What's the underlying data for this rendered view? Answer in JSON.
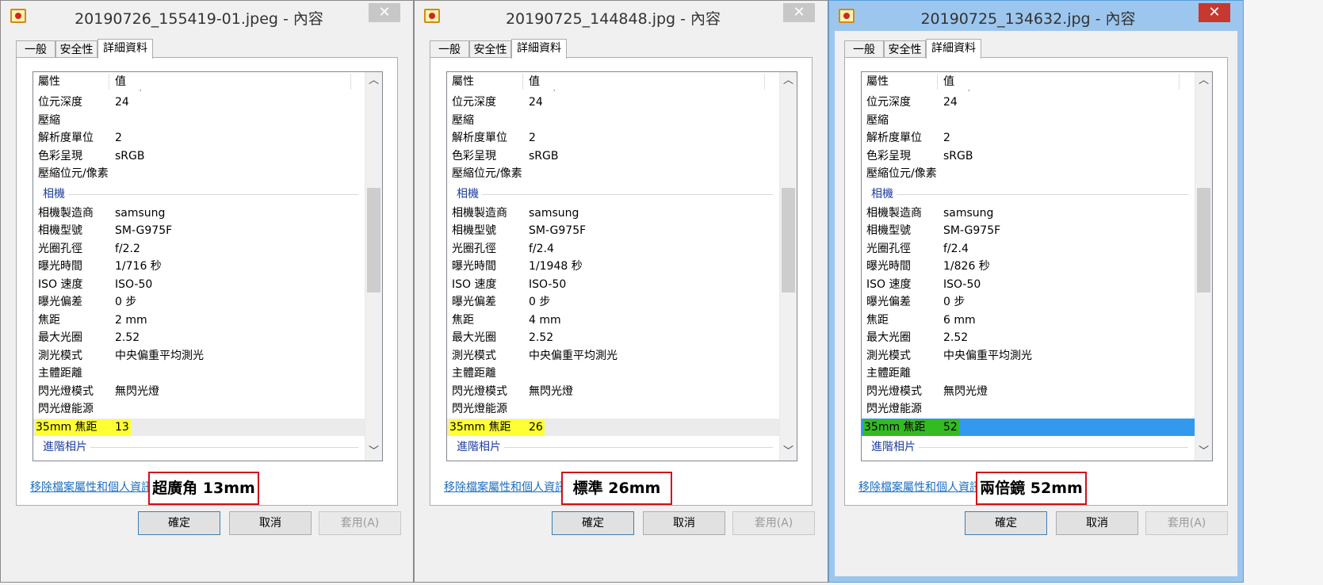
{
  "windows": [
    {
      "title": "20190726_155419-01.jpeg - 內容",
      "tabs": [
        "一般",
        "安全性",
        "詳細資料"
      ],
      "header": {
        "property": "屬性",
        "value": "值"
      },
      "rows": [
        {
          "k": "位元深度",
          "v": "24"
        },
        {
          "k": "壓縮",
          "v": ""
        },
        {
          "k": "解析度單位",
          "v": "2"
        },
        {
          "k": "色彩呈現",
          "v": "sRGB"
        },
        {
          "k": "壓縮位元/像素",
          "v": ""
        }
      ],
      "group_camera": "相機",
      "camera_rows": [
        {
          "k": "相機製造商",
          "v": "samsung"
        },
        {
          "k": "相機型號",
          "v": "SM-G975F"
        },
        {
          "k": "光圈孔徑",
          "v": "f/2.2"
        },
        {
          "k": "曝光時間",
          "v": "1/716 秒"
        },
        {
          "k": "ISO 速度",
          "v": "ISO-50"
        },
        {
          "k": "曝光偏差",
          "v": "0 步"
        },
        {
          "k": "焦距",
          "v": "2 mm"
        },
        {
          "k": "最大光圈",
          "v": "2.52"
        },
        {
          "k": "測光模式",
          "v": "中央偏重平均測光"
        },
        {
          "k": "主體距離",
          "v": ""
        },
        {
          "k": "閃光燈模式",
          "v": "無閃光燈"
        },
        {
          "k": "閃光燈能源",
          "v": ""
        },
        {
          "k": "35mm 焦距",
          "v": "13"
        }
      ],
      "group_advanced": "進階相片",
      "link": "移除檔案屬性和個人資訊",
      "annotation": "超廣角 13mm",
      "buttons": {
        "ok": "確定",
        "cancel": "取消",
        "apply": "套用(A)"
      }
    },
    {
      "title": "20190725_144848.jpg - 內容",
      "tabs": [
        "一般",
        "安全性",
        "詳細資料"
      ],
      "header": {
        "property": "屬性",
        "value": "值"
      },
      "rows": [
        {
          "k": "位元深度",
          "v": "24"
        },
        {
          "k": "壓縮",
          "v": ""
        },
        {
          "k": "解析度單位",
          "v": "2"
        },
        {
          "k": "色彩呈現",
          "v": "sRGB"
        },
        {
          "k": "壓縮位元/像素",
          "v": ""
        }
      ],
      "group_camera": "相機",
      "camera_rows": [
        {
          "k": "相機製造商",
          "v": "samsung"
        },
        {
          "k": "相機型號",
          "v": "SM-G975F"
        },
        {
          "k": "光圈孔徑",
          "v": "f/2.4"
        },
        {
          "k": "曝光時間",
          "v": "1/1948 秒"
        },
        {
          "k": "ISO 速度",
          "v": "ISO-50"
        },
        {
          "k": "曝光偏差",
          "v": "0 步"
        },
        {
          "k": "焦距",
          "v": "4 mm"
        },
        {
          "k": "最大光圈",
          "v": "2.52"
        },
        {
          "k": "測光模式",
          "v": "中央偏重平均測光"
        },
        {
          "k": "主體距離",
          "v": ""
        },
        {
          "k": "閃光燈模式",
          "v": "無閃光燈"
        },
        {
          "k": "閃光燈能源",
          "v": ""
        },
        {
          "k": "35mm 焦距",
          "v": "26"
        }
      ],
      "group_advanced": "進階相片",
      "link": "移除檔案屬性和個人資訊",
      "annotation": "標準 26mm",
      "buttons": {
        "ok": "確定",
        "cancel": "取消",
        "apply": "套用(A)"
      }
    },
    {
      "title": "20190725_134632.jpg - 內容",
      "tabs": [
        "一般",
        "安全性",
        "詳細資料"
      ],
      "header": {
        "property": "屬性",
        "value": "值"
      },
      "rows": [
        {
          "k": "位元深度",
          "v": "24"
        },
        {
          "k": "壓縮",
          "v": ""
        },
        {
          "k": "解析度單位",
          "v": "2"
        },
        {
          "k": "色彩呈現",
          "v": "sRGB"
        },
        {
          "k": "壓縮位元/像素",
          "v": ""
        }
      ],
      "group_camera": "相機",
      "camera_rows": [
        {
          "k": "相機製造商",
          "v": "samsung"
        },
        {
          "k": "相機型號",
          "v": "SM-G975F"
        },
        {
          "k": "光圈孔徑",
          "v": "f/2.4"
        },
        {
          "k": "曝光時間",
          "v": "1/826 秒"
        },
        {
          "k": "ISO 速度",
          "v": "ISO-50"
        },
        {
          "k": "曝光偏差",
          "v": "0 步"
        },
        {
          "k": "焦距",
          "v": "6 mm"
        },
        {
          "k": "最大光圈",
          "v": "2.52"
        },
        {
          "k": "測光模式",
          "v": "中央偏重平均測光"
        },
        {
          "k": "主體距離",
          "v": ""
        },
        {
          "k": "閃光燈模式",
          "v": "無閃光燈"
        },
        {
          "k": "閃光燈能源",
          "v": ""
        },
        {
          "k": "35mm 焦距",
          "v": "52"
        }
      ],
      "group_advanced": "進階相片",
      "link": "移除檔案屬性和個人資訊",
      "annotation": "兩倍鏡 52mm",
      "buttons": {
        "ok": "確定",
        "cancel": "取消",
        "apply": "套用(A)"
      }
    }
  ],
  "colors": {
    "highlight_yellow": "#ffff33",
    "highlight_green": "#33bb22",
    "selection_blue": "#3399ee",
    "annotation_border": "#d0101a"
  }
}
